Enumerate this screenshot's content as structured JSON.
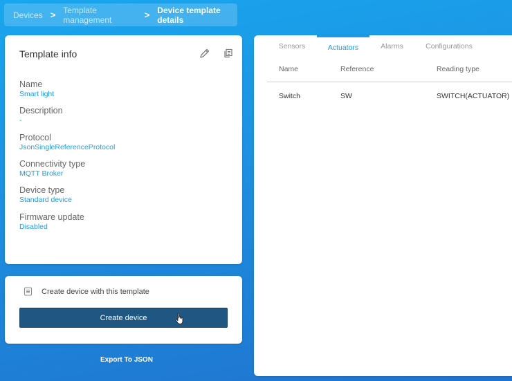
{
  "breadcrumb": {
    "items": [
      "Devices",
      "Template management"
    ],
    "current": "Device template details",
    "separator": ">"
  },
  "template_info": {
    "title": "Template info",
    "edit_icon": "pencil-icon",
    "copy_icon": "copy-icon",
    "fields": [
      {
        "label": "Name",
        "value": "Smart light"
      },
      {
        "label": "Description",
        "value": "-"
      },
      {
        "label": "Protocol",
        "value": "JsonSingleReferenceProtocol"
      },
      {
        "label": "Connectivity type",
        "value": "MQTT Broker"
      },
      {
        "label": "Device type",
        "value": "Standard device"
      },
      {
        "label": "Firmware update",
        "value": "Disabled"
      }
    ]
  },
  "create": {
    "text": "Create device with this template",
    "button_label": "Create device",
    "icon": "document-icon"
  },
  "export_label": "Export To JSON",
  "tabs": {
    "items": [
      "Sensors",
      "Actuators",
      "Alarms",
      "Configurations"
    ],
    "active": "Actuators"
  },
  "table": {
    "columns": [
      "Name",
      "Reference",
      "Reading type"
    ],
    "rows": [
      {
        "name": "Switch",
        "reference": "SW",
        "reading_type": "SWITCH(ACTUATOR)"
      }
    ]
  },
  "colors": {
    "accent": "#1a9be8",
    "button": "#1f5682",
    "background_start": "#19a6ee",
    "background_end": "#1f74cf"
  }
}
